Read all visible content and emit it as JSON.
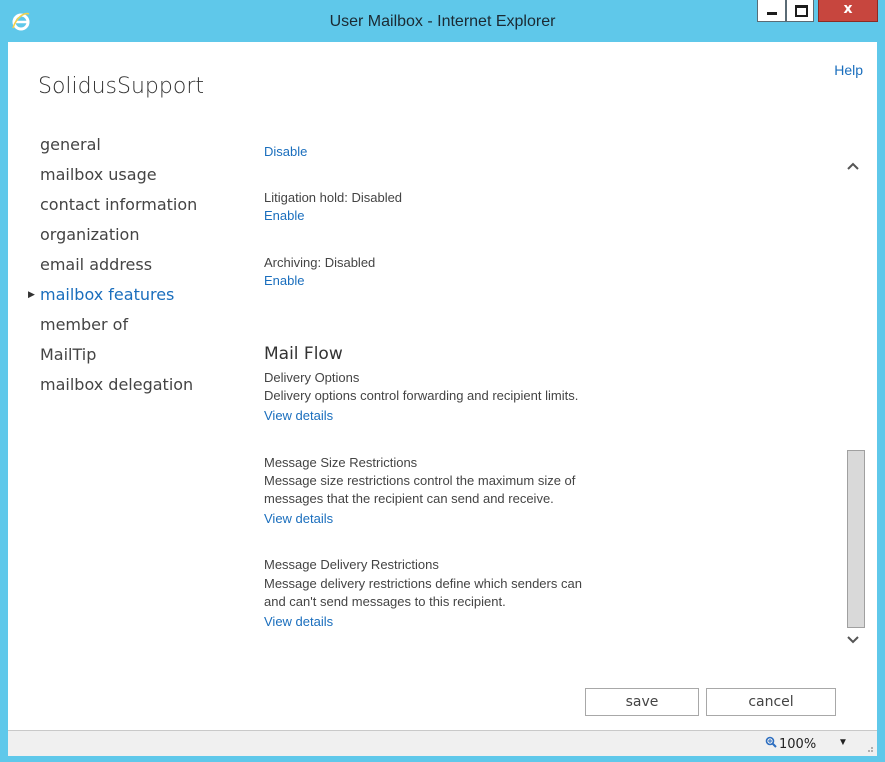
{
  "window": {
    "title": "User Mailbox - Internet Explorer",
    "close_glyph": "x"
  },
  "header": {
    "mailbox_name": "SolidusSupport",
    "help_label": "Help"
  },
  "nav": {
    "items": [
      {
        "label": "general"
      },
      {
        "label": "mailbox usage"
      },
      {
        "label": "contact information"
      },
      {
        "label": "organization"
      },
      {
        "label": "email address"
      },
      {
        "label": "mailbox features"
      },
      {
        "label": "member of"
      },
      {
        "label": "MailTip"
      },
      {
        "label": "mailbox delegation"
      }
    ],
    "active_index": 5
  },
  "main": {
    "top_disable_link": "Disable",
    "litigation": {
      "status": "Litigation hold: Disabled",
      "action": "Enable"
    },
    "archiving": {
      "status": "Archiving: Disabled",
      "action": "Enable"
    },
    "mail_flow": {
      "title": "Mail Flow",
      "delivery": {
        "heading": "Delivery Options",
        "desc": "Delivery options control forwarding and recipient limits.",
        "link": "View details"
      },
      "size": {
        "heading": "Message Size Restrictions",
        "desc_line1": "Message size restrictions control the maximum size of",
        "desc_line2": "messages that the recipient can send and receive.",
        "link": "View details"
      },
      "restrictions": {
        "heading": "Message Delivery Restrictions",
        "desc_line1": "Message delivery restrictions define which senders can",
        "desc_line2": "and can't send messages to this recipient.",
        "link": "View details"
      }
    }
  },
  "buttons": {
    "save": "save",
    "cancel": "cancel"
  },
  "statusbar": {
    "zoom": "100%"
  },
  "icons": {
    "window": "internet-explorer-icon",
    "nav_active": "triangle-right-icon",
    "scroll_up": "chevron-up-icon",
    "scroll_down": "chevron-down-icon",
    "zoom": "magnifier-icon",
    "zoom_dropdown": "caret-down-icon"
  },
  "colors": {
    "titlebar": "#5fc8ea",
    "link": "#1a6ebd",
    "close_button": "#c7463e"
  }
}
